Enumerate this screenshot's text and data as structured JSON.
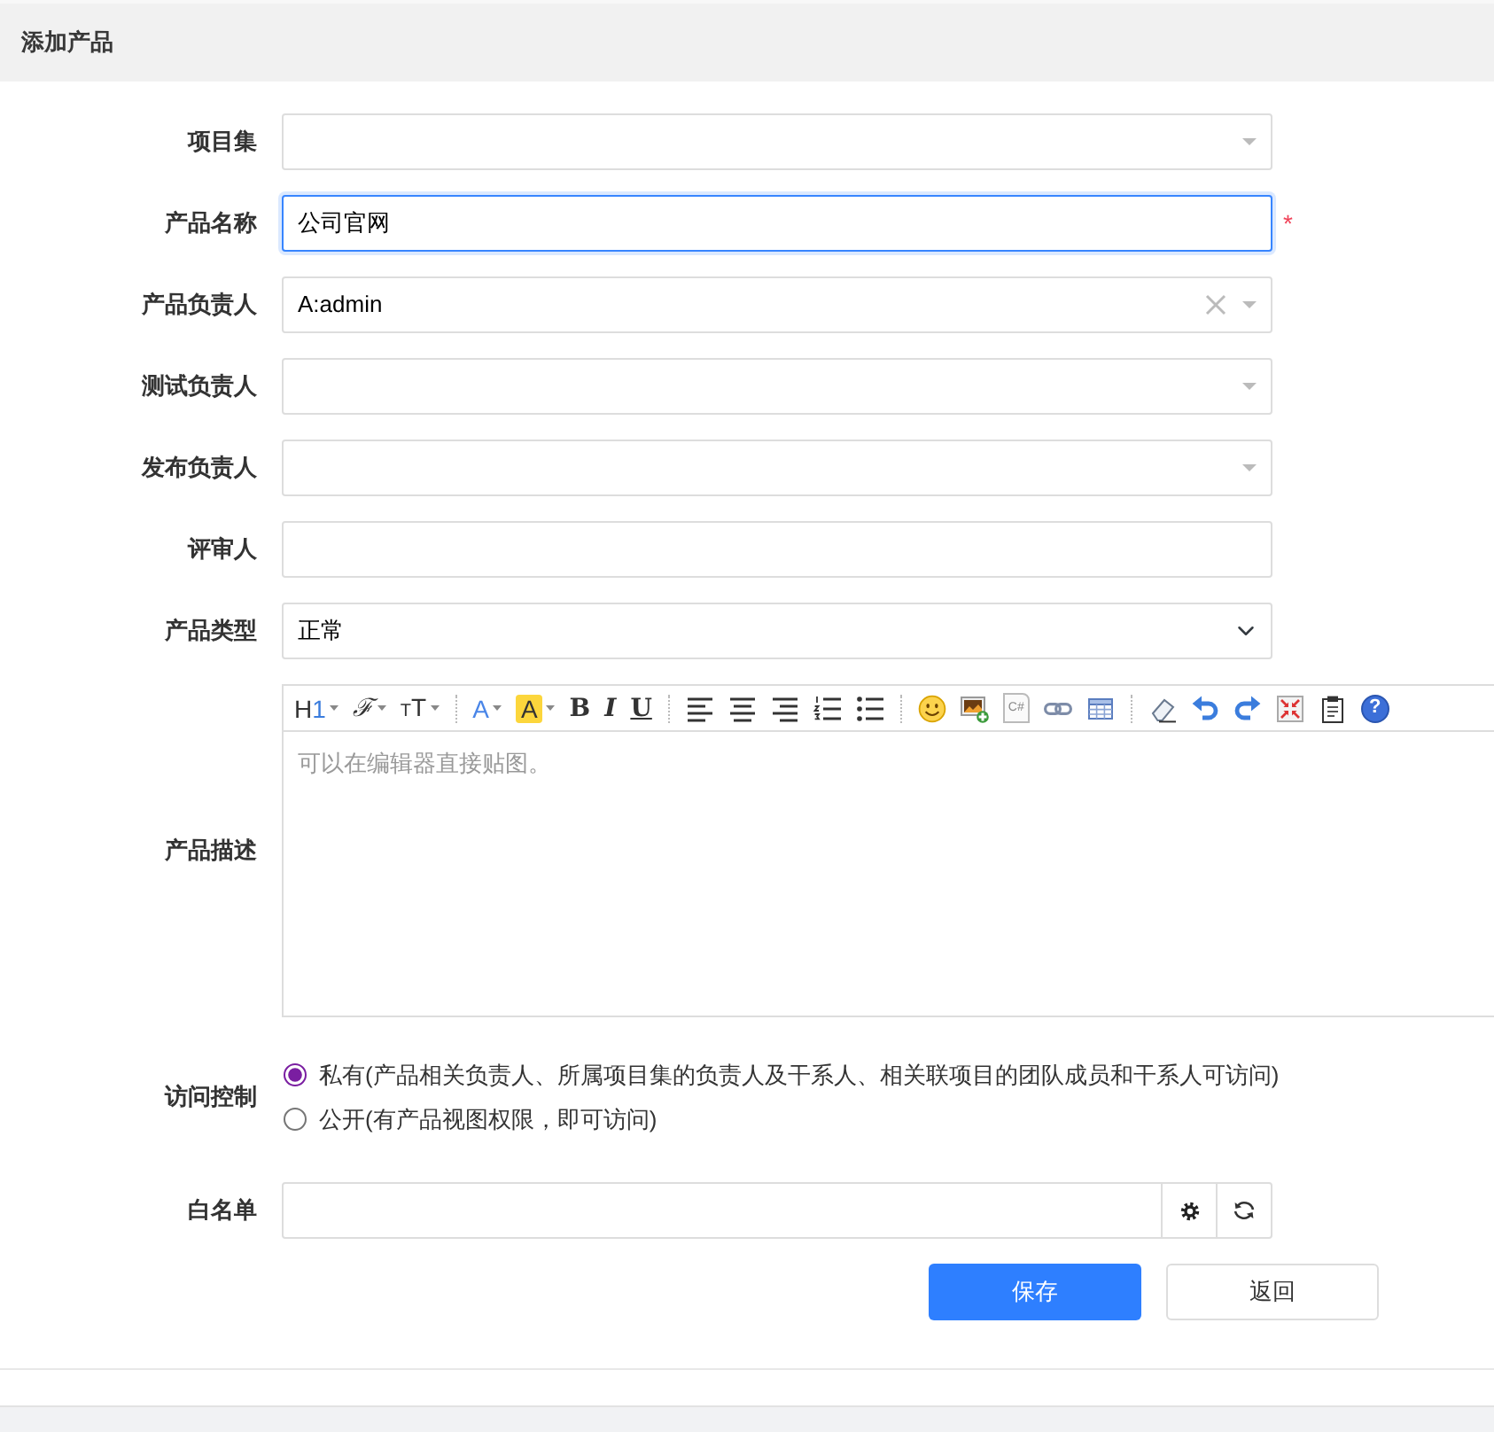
{
  "header": {
    "title": "添加产品"
  },
  "fields": [
    {
      "kind": "picker",
      "label": "项目集",
      "focused": false
    },
    {
      "kind": "input",
      "label": "产品名称",
      "value": "公司官网",
      "focused": true,
      "required_mark": "*"
    },
    {
      "kind": "picker",
      "label": "产品负责人",
      "value": "A:admin",
      "focused": false
    },
    {
      "kind": "picker",
      "label": "测试负责人",
      "focused": false
    },
    {
      "kind": "picker",
      "label": "发布负责人",
      "focused": false
    },
    {
      "kind": "input",
      "label": "评审人",
      "focused": false
    },
    {
      "kind": "select",
      "label": "产品类型",
      "value": "正常"
    },
    {
      "kind": "editor",
      "label": "产品描述",
      "placeholder": "可以在编辑器直接贴图。",
      "toolbar": [
        [
          {
            "kind": "heading",
            "label": "H1",
            "dropdown": true
          },
          {
            "kind": "font",
            "label": "ℱ",
            "dropdown": true
          },
          {
            "kind": "size",
            "label": "TT",
            "dropdown": true
          }
        ],
        [
          {
            "kind": "color",
            "label": "A",
            "dropdown": true
          },
          {
            "kind": "highlight",
            "label": "A",
            "dropdown": true
          },
          {
            "kind": "bold",
            "label": "B",
            "dropdown": false
          },
          {
            "kind": "italic",
            "label": "I",
            "dropdown": false
          },
          {
            "kind": "underline",
            "label": "U",
            "dropdown": false
          }
        ],
        [
          {
            "kind": "align-left",
            "dropdown": false
          },
          {
            "kind": "align-center",
            "dropdown": false
          },
          {
            "kind": "align-right",
            "dropdown": false
          },
          {
            "kind": "ordered-list",
            "dropdown": false
          },
          {
            "kind": "bullet-list",
            "dropdown": false
          }
        ],
        [
          {
            "kind": "emoji",
            "dropdown": false
          },
          {
            "kind": "image",
            "dropdown": false
          },
          {
            "kind": "code",
            "label": "C#",
            "dropdown": false
          },
          {
            "kind": "link",
            "dropdown": false
          },
          {
            "kind": "table",
            "dropdown": false
          }
        ],
        [
          {
            "kind": "eraser",
            "dropdown": false
          },
          {
            "kind": "undo",
            "dropdown": false
          },
          {
            "kind": "redo",
            "dropdown": false
          },
          {
            "kind": "fullscreen",
            "dropdown": false
          },
          {
            "kind": "paste",
            "dropdown": false
          },
          {
            "kind": "help",
            "label": "?",
            "dropdown": false
          }
        ]
      ]
    },
    {
      "kind": "radios",
      "label": "访问控制",
      "options": [
        {
          "label": "私有(产品相关负责人、所属项目集的负责人及干系人、相关联项目的团队成员和干系人可访问)",
          "selected": true
        },
        {
          "label": "公开(有产品视图权限，即可访问)",
          "selected": false
        }
      ]
    },
    {
      "kind": "whitelist",
      "label": "白名单"
    }
  ],
  "buttons": [
    {
      "kind": "primary",
      "label": "保存"
    },
    {
      "kind": "default",
      "label": "返回"
    }
  ]
}
